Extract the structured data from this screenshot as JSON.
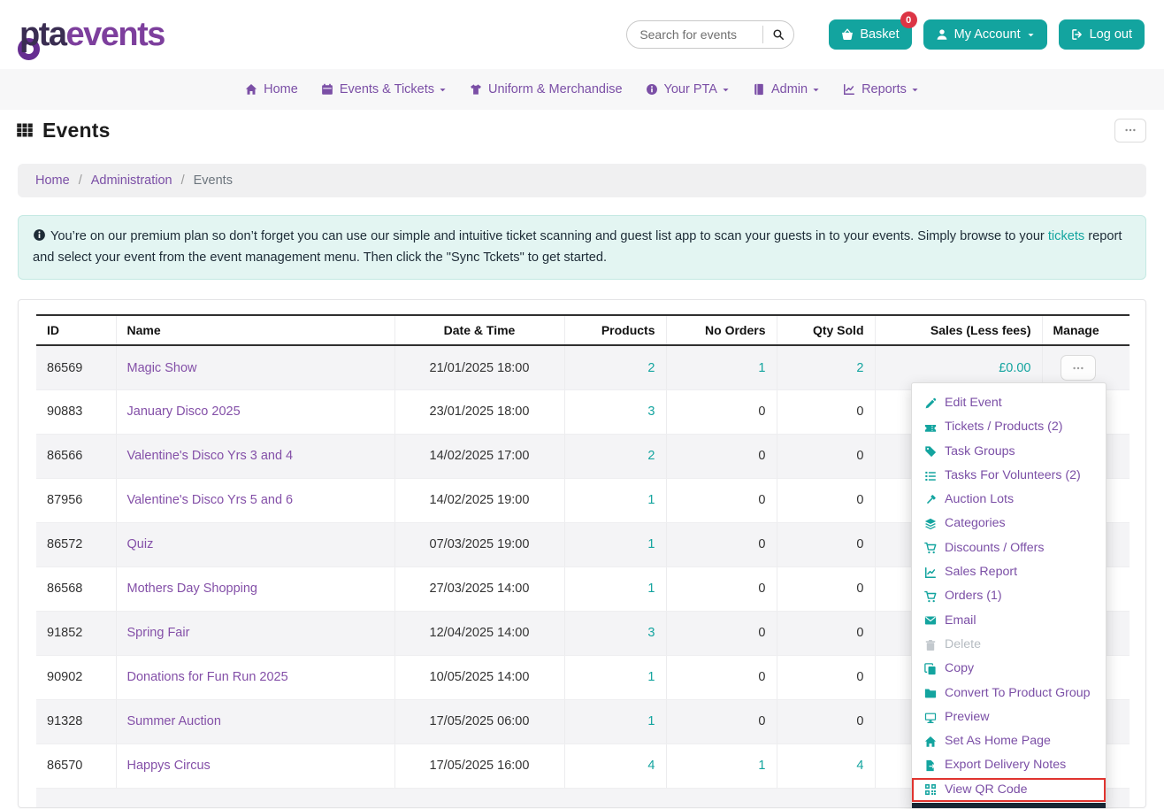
{
  "brand": {
    "pta": "pta",
    "events": "events"
  },
  "header": {
    "search_placeholder": "Search for events",
    "basket_label": "Basket",
    "basket_badge": "0",
    "my_account_label": "My Account",
    "logout_label": "Log out"
  },
  "nav": {
    "items": [
      {
        "label": "Home",
        "icon": "home",
        "caret": false
      },
      {
        "label": "Events & Tickets",
        "icon": "calendar",
        "caret": true
      },
      {
        "label": "Uniform & Merchandise",
        "icon": "tshirt",
        "caret": false
      },
      {
        "label": "Your PTA",
        "icon": "info",
        "caret": true
      },
      {
        "label": "Admin",
        "icon": "book",
        "caret": true
      },
      {
        "label": "Reports",
        "icon": "chartline",
        "caret": true
      }
    ]
  },
  "page": {
    "title": "Events",
    "more_button_icon": "ellipsis-icon"
  },
  "breadcrumb": {
    "items": [
      "Home",
      "Administration",
      "Events"
    ],
    "separator": "/"
  },
  "alert": {
    "icon": "info-icon",
    "before": "You’re on our premium plan so don’t forget you can use our simple and intuitive ticket scanning and guest list app to scan your guests in to your events. Simply browse to your ",
    "link": "tickets",
    "after": " report and select your event from the event management menu. Then click the \"Sync Tckets\" to get started."
  },
  "table": {
    "headers": [
      "ID",
      "Name",
      "Date & Time",
      "Products",
      "No Orders",
      "Qty Sold",
      "Sales (Less fees)",
      "Manage"
    ],
    "manage_button_icon": "ellipsis-icon",
    "rows": [
      {
        "id": "86569",
        "name": "Magic Show",
        "date": "21/01/2025 18:00",
        "products": "2",
        "no_orders": "1",
        "qty_sold": "2",
        "sales": "£0.00"
      },
      {
        "id": "90883",
        "name": "January Disco 2025",
        "date": "23/01/2025 18:00",
        "products": "3",
        "no_orders": "0",
        "qty_sold": "0",
        "sales": ""
      },
      {
        "id": "86566",
        "name": "Valentine's Disco Yrs 3 and 4",
        "date": "14/02/2025 17:00",
        "products": "2",
        "no_orders": "0",
        "qty_sold": "0",
        "sales": ""
      },
      {
        "id": "87956",
        "name": "Valentine's Disco Yrs 5 and 6",
        "date": "14/02/2025 19:00",
        "products": "1",
        "no_orders": "0",
        "qty_sold": "0",
        "sales": ""
      },
      {
        "id": "86572",
        "name": "Quiz",
        "date": "07/03/2025 19:00",
        "products": "1",
        "no_orders": "0",
        "qty_sold": "0",
        "sales": ""
      },
      {
        "id": "86568",
        "name": "Mothers Day Shopping",
        "date": "27/03/2025 14:00",
        "products": "1",
        "no_orders": "0",
        "qty_sold": "0",
        "sales": ""
      },
      {
        "id": "91852",
        "name": "Spring Fair",
        "date": "12/04/2025 14:00",
        "products": "3",
        "no_orders": "0",
        "qty_sold": "0",
        "sales": ""
      },
      {
        "id": "90902",
        "name": "Donations for Fun Run 2025",
        "date": "10/05/2025 14:00",
        "products": "1",
        "no_orders": "0",
        "qty_sold": "0",
        "sales": ""
      },
      {
        "id": "91328",
        "name": "Summer Auction",
        "date": "17/05/2025 06:00",
        "products": "1",
        "no_orders": "0",
        "qty_sold": "0",
        "sales": ""
      },
      {
        "id": "86570",
        "name": "Happys Circus",
        "date": "17/05/2025 16:00",
        "products": "4",
        "no_orders": "1",
        "qty_sold": "4",
        "sales": ""
      }
    ]
  },
  "menu": {
    "items": [
      {
        "label": "Edit Event",
        "icon": "edit"
      },
      {
        "label": "Tickets / Products (2)",
        "icon": "ticket"
      },
      {
        "label": "Task Groups",
        "icon": "tag"
      },
      {
        "label": "Tasks For Volunteers (2)",
        "icon": "tasks"
      },
      {
        "label": "Auction Lots",
        "icon": "gavel"
      },
      {
        "label": "Categories",
        "icon": "layers"
      },
      {
        "label": "Discounts / Offers",
        "icon": "cart"
      },
      {
        "label": "Sales Report",
        "icon": "chartline"
      },
      {
        "label": "Orders (1)",
        "icon": "cart"
      },
      {
        "label": "Email",
        "icon": "envelope"
      },
      {
        "label": "Delete",
        "icon": "trash",
        "disabled": true
      },
      {
        "label": "Copy",
        "icon": "copy"
      },
      {
        "label": "Convert To Product Group",
        "icon": "folder"
      },
      {
        "label": "Preview",
        "icon": "desktop"
      },
      {
        "label": "Set As Home Page",
        "icon": "home"
      },
      {
        "label": "Export Delivery Notes",
        "icon": "fileexport"
      },
      {
        "label": "View QR Code",
        "icon": "qrcode",
        "highlighted": true
      }
    ]
  },
  "colors": {
    "accent_teal": "#13a49f",
    "brand_purple_dark": "#3a2d52",
    "brand_purple": "#7d3f9d",
    "nav_purple": "#7b4fa6",
    "badge_red": "#dc3545",
    "highlight_red": "#e0342f",
    "alert_bg": "#e3f5f2"
  }
}
